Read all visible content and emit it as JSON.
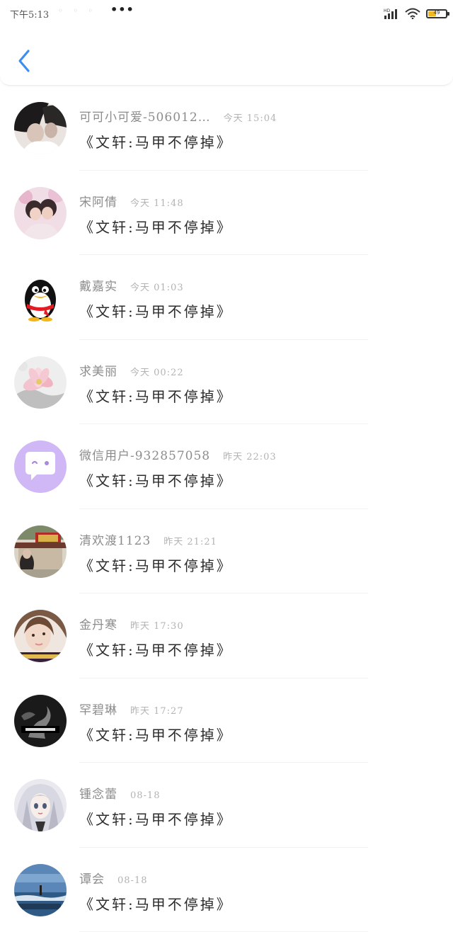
{
  "status_bar": {
    "time": "下午5:13",
    "signal_badge": "HD",
    "battery_level": "49"
  },
  "header": {
    "back_icon": "chevron-left-icon"
  },
  "contacts": [
    {
      "name": "可可小可爱-506012…",
      "time": "今天 15:04",
      "message": "《文轩:马甲不停掉》",
      "avatar": "photo-couple"
    },
    {
      "name": "宋阿倩",
      "time": "今天 11:48",
      "message": "《文轩:马甲不停掉》",
      "avatar": "photo-pink-couple"
    },
    {
      "name": "戴嘉实",
      "time": "今天 01:03",
      "message": "《文轩:马甲不停掉》",
      "avatar": "penguin"
    },
    {
      "name": "求美丽",
      "time": "今天 00:22",
      "message": "《文轩:马甲不停掉》",
      "avatar": "lotus"
    },
    {
      "name": "微信用户-932857058",
      "time": "昨天 22:03",
      "message": "《文轩:马甲不停掉》",
      "avatar": "default-chat"
    },
    {
      "name": "清欢渡1123",
      "time": "昨天 21:21",
      "message": "《文轩:马甲不停掉》",
      "avatar": "photo-temple"
    },
    {
      "name": "金丹寒",
      "time": "昨天 17:30",
      "message": "《文轩:马甲不停掉》",
      "avatar": "photo-girl"
    },
    {
      "name": "罕碧琳",
      "time": "昨天 17:27",
      "message": "《文轩:马甲不停掉》",
      "avatar": "photo-smoke"
    },
    {
      "name": "锺念蕾",
      "time": "08-18",
      "message": "《文轩:马甲不停掉》",
      "avatar": "anime-girl"
    },
    {
      "name": "谭会",
      "time": "08-18",
      "message": "《文轩:马甲不停掉》",
      "avatar": "photo-sea"
    }
  ],
  "colors": {
    "accent": "#3d8ef0",
    "battery": "#f2b821",
    "default_avatar": "#cfb8f5"
  }
}
